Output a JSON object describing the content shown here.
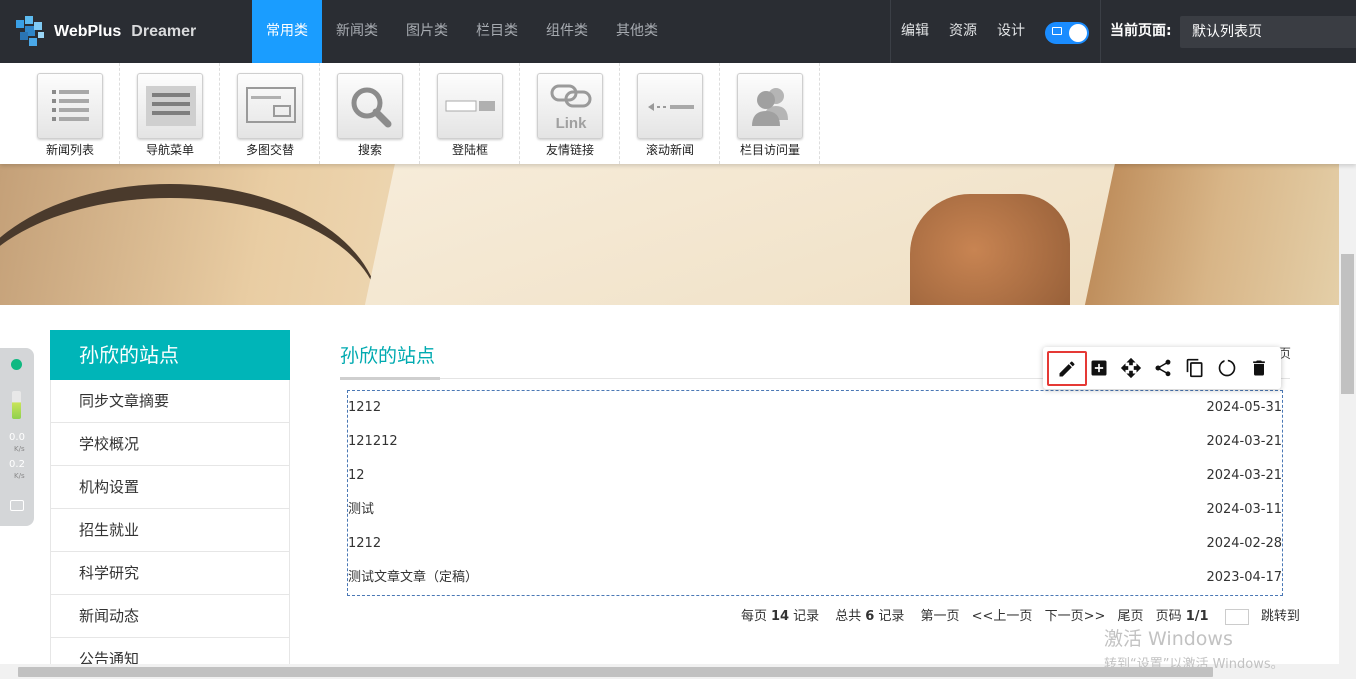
{
  "topbar": {
    "brand_name": "WebPlus",
    "brand_suffix": "Dreamer",
    "tabs": [
      {
        "label": "常用类",
        "active": true
      },
      {
        "label": "新闻类"
      },
      {
        "label": "图片类"
      },
      {
        "label": "栏目类"
      },
      {
        "label": "组件类"
      },
      {
        "label": "其他类"
      }
    ],
    "actions": {
      "edit": "编辑",
      "resources": "资源",
      "design": "设计"
    },
    "current_page_label": "当前页面:",
    "current_page_value": "默认列表页",
    "accent_color": "#1a9dff"
  },
  "components": [
    {
      "label": "新闻列表",
      "icon": "news-list-icon"
    },
    {
      "label": "导航菜单",
      "icon": "nav-menu-icon"
    },
    {
      "label": "多图交替",
      "icon": "multi-image-icon"
    },
    {
      "label": "搜索",
      "icon": "search-icon"
    },
    {
      "label": "登陆框",
      "icon": "login-box-icon"
    },
    {
      "label": "友情链接",
      "icon": "link-icon"
    },
    {
      "label": "滚动新闻",
      "icon": "scroll-news-icon"
    },
    {
      "label": "栏目访问量",
      "icon": "visitors-icon"
    }
  ],
  "sidebar": {
    "title": "孙欣的站点",
    "items": [
      "同步文章摘要",
      "学校概况",
      "机构设置",
      "招生就业",
      "科学研究",
      "新闻动态",
      "公告通知"
    ]
  },
  "section": {
    "title": "孙欣的站点",
    "more_label": "页"
  },
  "articles": [
    {
      "title": "1212",
      "date": "2024-05-31"
    },
    {
      "title": "121212",
      "date": "2024-03-21"
    },
    {
      "title": "12",
      "date": "2024-03-21"
    },
    {
      "title": "测试",
      "date": "2024-03-11"
    },
    {
      "title": "1212",
      "date": "2024-02-28"
    },
    {
      "title": "测试文章文章（定稿）",
      "date": "2023-04-17"
    }
  ],
  "pager": {
    "per_page_prefix": "每页",
    "per_page": "14",
    "per_page_suffix": "记录",
    "total_prefix": "总共",
    "total": "6",
    "total_suffix": "记录",
    "first": "第一页",
    "prev": "<<上一页",
    "next": "下一页>>",
    "last": "尾页",
    "page_prefix": "页码",
    "page": "1/1",
    "jump": "跳转到"
  },
  "toolbar_icons": [
    "edit-icon",
    "add-icon",
    "move-icon",
    "share-icon",
    "copy-icon",
    "refresh-icon",
    "delete-icon"
  ],
  "netwidget": {
    "up": "0.0",
    "down": "0.2",
    "unit": "K/s"
  },
  "watermark": {
    "line1": "激活 Windows",
    "line2": "转到“设置”以激活 Windows。"
  }
}
